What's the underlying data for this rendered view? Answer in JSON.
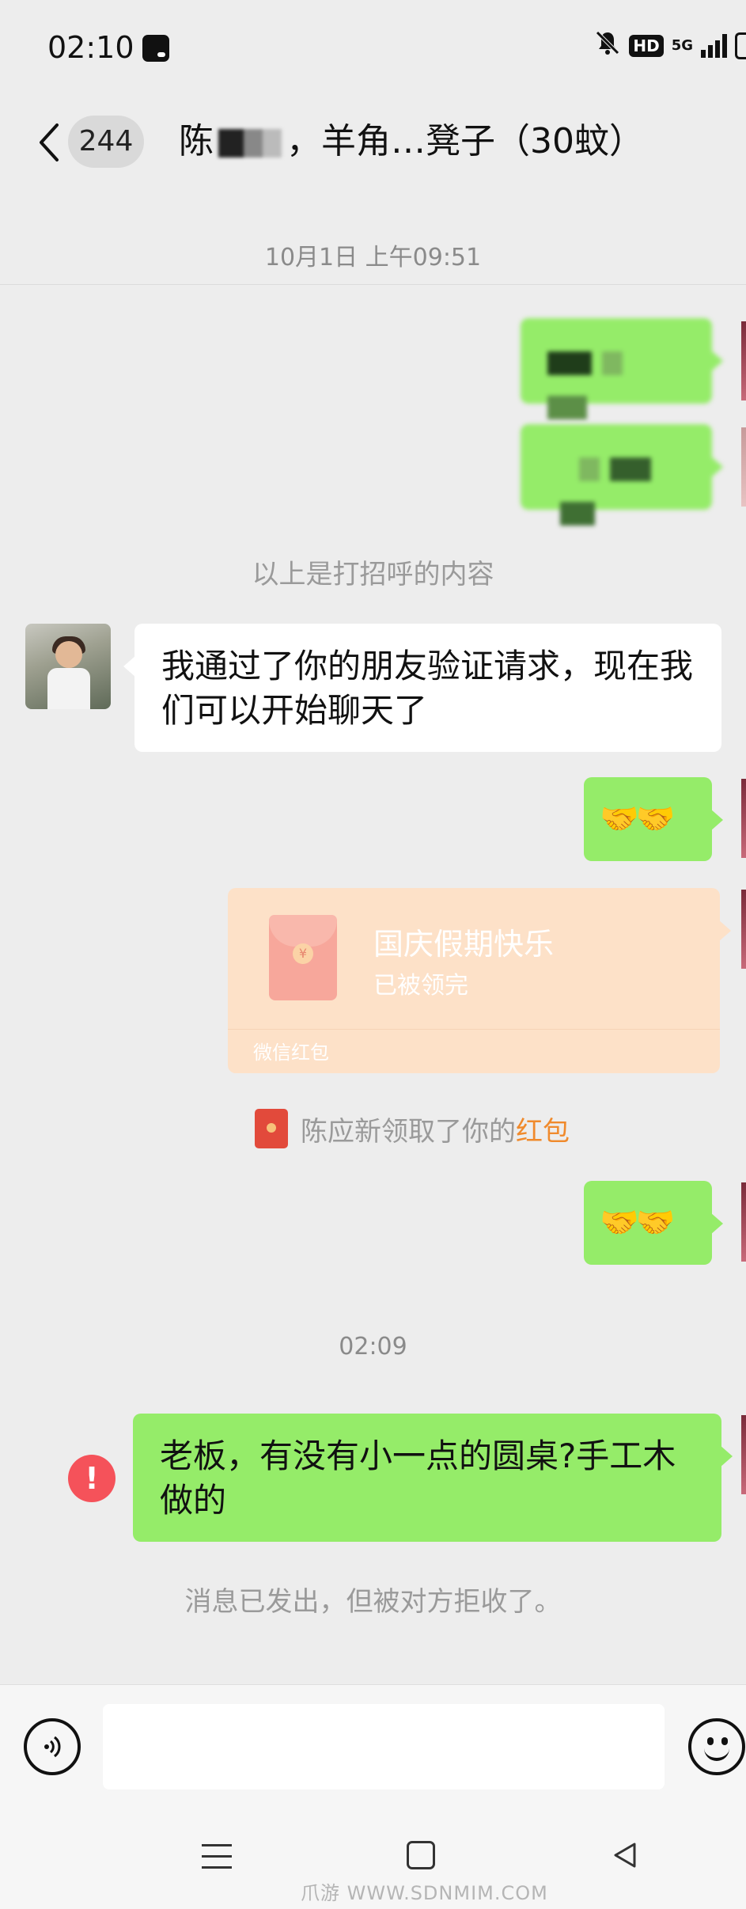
{
  "status_bar": {
    "time": "02:10",
    "hd_badge": "HD",
    "network": "5G",
    "icons": [
      "mute-bell-icon",
      "signal-icon",
      "battery-icon"
    ]
  },
  "header": {
    "unread_count": "244",
    "title_prefix": "陈",
    "title_suffix": "，羊角…凳子（30蚊）"
  },
  "messages": {
    "timestamp_1": "10月1日 上午09:51",
    "greeting_notice": "以上是打招呼的内容",
    "friend_accept": "我通过了你的朋友验证请求，现在我们可以开始聊天了",
    "handshake_1": "🤝🤝",
    "red_packet": {
      "title": "国庆假期快乐",
      "status": "已被领完",
      "footer": "微信红包"
    },
    "red_packet_notice": "陈应新领取了你的",
    "red_packet_link": "红包",
    "handshake_2": "🤝🤝",
    "timestamp_2": "02:09",
    "last_message": "老板，有没有小一点的圆桌?手工木做的",
    "rejected_notice": "消息已发出，但被对方拒收了。",
    "error_mark": "!"
  },
  "input": {
    "value": "",
    "placeholder": ""
  },
  "watermark": "爪游 WWW.SDNMIM.COM",
  "colors": {
    "background": "#ededed",
    "bubble_me": "#95ec69",
    "bubble_other": "#ffffff",
    "red_packet_bg": "#fde1c8",
    "link_orange": "#f08a2c",
    "error_red": "#f5525a"
  }
}
